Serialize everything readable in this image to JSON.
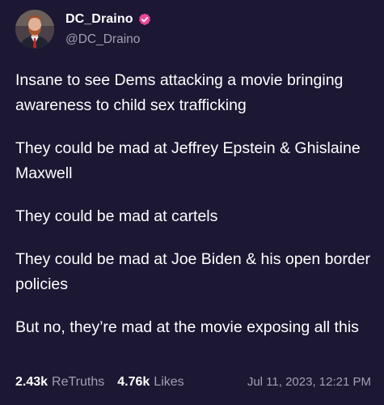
{
  "author": {
    "display_name": "DC_Draino",
    "handle": "@DC_Draino",
    "verified": true,
    "verified_color": "#ec4899"
  },
  "post": {
    "paragraphs": [
      "Insane to see Dems attacking a movie bringing awareness to child sex trafficking",
      "They could be mad at Jeffrey Epstein & Ghislaine Maxwell",
      "They could be mad at cartels",
      "They could be mad at Joe Biden & his open border policies",
      "But no, they’re mad at the movie exposing all this"
    ]
  },
  "stats": {
    "retruths_count": "2.43k",
    "retruths_label": "ReTruths",
    "likes_count": "4.76k",
    "likes_label": "Likes",
    "timestamp": "Jul 11, 2023, 12:21 PM"
  },
  "colors": {
    "background": "#1c1733",
    "text": "#ffffff",
    "muted": "#a39fb3"
  }
}
